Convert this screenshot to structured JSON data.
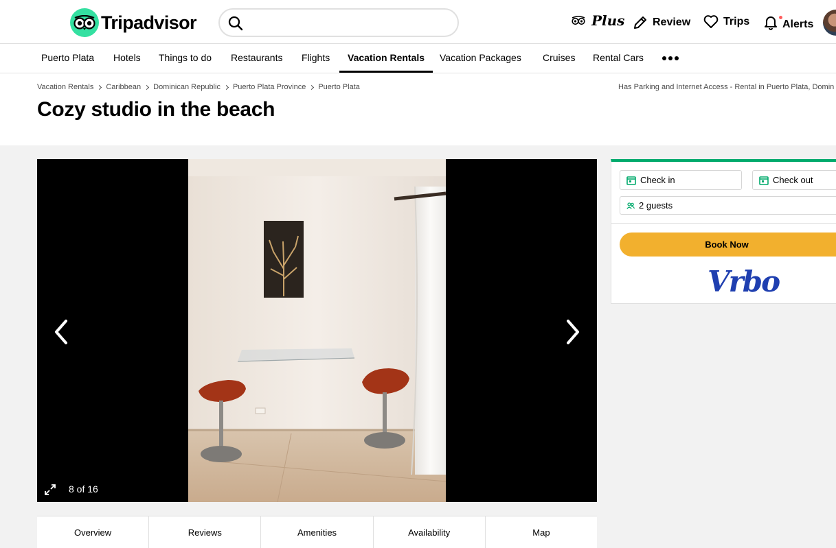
{
  "header": {
    "logo_text": "Tripadvisor",
    "search": {
      "placeholder": "",
      "value": ""
    },
    "plus_label": "Plus",
    "review_label": "Review",
    "trips_label": "Trips",
    "alerts_label": "Alerts"
  },
  "nav": {
    "items": [
      "Puerto Plata",
      "Hotels",
      "Things to do",
      "Restaurants",
      "Flights",
      "Vacation Rentals",
      "Vacation Packages",
      "Cruises",
      "Rental Cars"
    ],
    "active": "Vacation Rentals"
  },
  "breadcrumb": {
    "items": [
      "Vacation Rentals",
      "Caribbean",
      "Dominican Republic",
      "Puerto Plata Province",
      "Puerto Plata"
    ],
    "right_text": "Has Parking and Internet Access - Rental in Puerto Plata, Domin"
  },
  "listing": {
    "title": "Cozy studio in the beach"
  },
  "gallery": {
    "counter": "8 of 16"
  },
  "tabs": [
    "Overview",
    "Reviews",
    "Amenities",
    "Availability",
    "Map"
  ],
  "booking": {
    "check_in": "Check in",
    "check_out": "Check out",
    "guests": "2 guests",
    "book_now": "Book Now",
    "provider": "Vrbo"
  },
  "colors": {
    "brand_green": "#34e0a1",
    "booking_top_border": "#00aa6c",
    "book_button": "#f2b02e",
    "vrbo_blue": "#1f3fb0"
  }
}
